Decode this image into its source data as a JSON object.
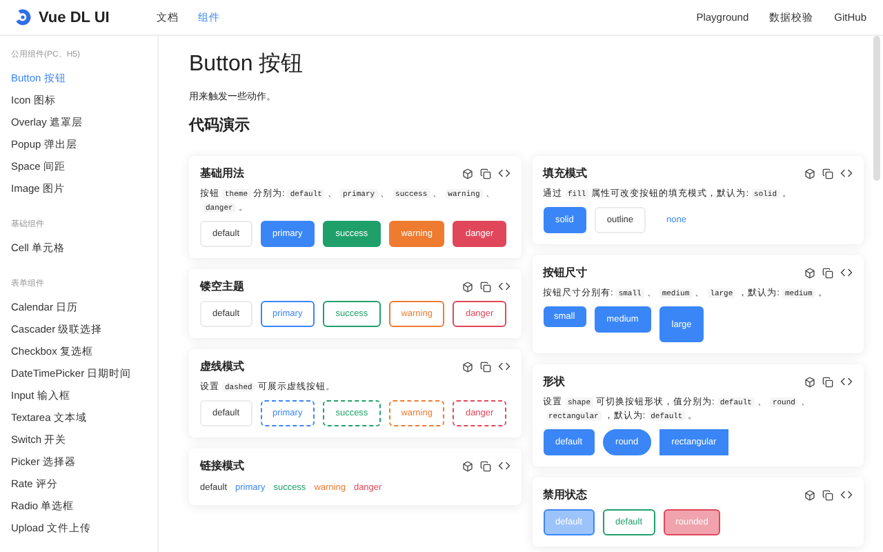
{
  "header": {
    "brand": "Vue DL UI",
    "nav": [
      {
        "label": "文档",
        "selected": false
      },
      {
        "label": "组件",
        "selected": true
      }
    ],
    "links": [
      "Playground",
      "数据校验",
      "GitHub"
    ]
  },
  "sidebar": {
    "groups": [
      {
        "label": "公用组件(PC、H5)",
        "items": [
          {
            "label": "Button 按钮",
            "selected": true
          },
          {
            "label": "Icon 图标",
            "selected": false
          },
          {
            "label": "Overlay 遮罩层",
            "selected": false
          },
          {
            "label": "Popup 弹出层",
            "selected": false
          },
          {
            "label": "Space 间距",
            "selected": false
          },
          {
            "label": "Image 图片",
            "selected": false
          }
        ]
      },
      {
        "label": "基础组件",
        "items": [
          {
            "label": "Cell 单元格",
            "selected": false
          }
        ]
      },
      {
        "label": "表单组件",
        "items": [
          {
            "label": "Calendar 日历",
            "selected": false
          },
          {
            "label": "Cascader 级联选择",
            "selected": false
          },
          {
            "label": "Checkbox 复选框",
            "selected": false
          },
          {
            "label": "DateTimePicker 日期时间",
            "selected": false
          },
          {
            "label": "Input 输入框",
            "selected": false
          },
          {
            "label": "Textarea 文本域",
            "selected": false
          },
          {
            "label": "Switch 开关",
            "selected": false
          },
          {
            "label": "Picker 选择器",
            "selected": false
          },
          {
            "label": "Rate 评分",
            "selected": false
          },
          {
            "label": "Radio 单选框",
            "selected": false
          },
          {
            "label": "Upload 文件上传",
            "selected": false
          }
        ]
      }
    ]
  },
  "page": {
    "title": "Button 按钮",
    "intro": "用来触发一些动作。",
    "section": "代码演示"
  },
  "columns": [
    [
      {
        "title": "基础用法",
        "description": [
          {
            "kind": "text",
            "text": "按钮"
          },
          {
            "kind": "code",
            "text": "theme"
          },
          {
            "kind": "text",
            "text": "分别为:"
          },
          {
            "kind": "code",
            "text": "default"
          },
          {
            "kind": "text",
            "text": "、"
          },
          {
            "kind": "code",
            "text": "primary"
          },
          {
            "kind": "text",
            "text": "、"
          },
          {
            "kind": "code",
            "text": "success"
          },
          {
            "kind": "text",
            "text": "、"
          },
          {
            "kind": "code",
            "text": "warning"
          },
          {
            "kind": "text",
            "text": "、"
          },
          {
            "kind": "code",
            "text": "danger"
          },
          {
            "kind": "text",
            "text": "。"
          }
        ],
        "buttons": [
          {
            "label": "default",
            "kind": "plain",
            "color": "#333333"
          },
          {
            "label": "primary",
            "kind": "solid",
            "color": "#3a86f7"
          },
          {
            "label": "success",
            "kind": "solid",
            "color": "#1fa06a"
          },
          {
            "label": "warning",
            "kind": "solid",
            "color": "#ee7b30"
          },
          {
            "label": "danger",
            "kind": "solid",
            "color": "#e0475a"
          }
        ]
      },
      {
        "title": "镂空主题",
        "buttons": [
          {
            "label": "default",
            "kind": "plain",
            "color": "#333333"
          },
          {
            "label": "primary",
            "kind": "ghost",
            "color": "#3a86f7"
          },
          {
            "label": "success",
            "kind": "ghost",
            "color": "#1fa06a"
          },
          {
            "label": "warning",
            "kind": "ghost",
            "color": "#ee7b30"
          },
          {
            "label": "danger",
            "kind": "ghost",
            "color": "#e0475a"
          }
        ]
      },
      {
        "title": "虚线模式",
        "description": [
          {
            "kind": "text",
            "text": "设置"
          },
          {
            "kind": "code",
            "text": "dashed"
          },
          {
            "kind": "text",
            "text": "可展示虚线按钮。"
          }
        ],
        "buttons": [
          {
            "label": "default",
            "kind": "plain",
            "color": "#333333"
          },
          {
            "label": "primary",
            "kind": "dashed",
            "color": "#3a86f7"
          },
          {
            "label": "success",
            "kind": "dashed",
            "color": "#1fa06a"
          },
          {
            "label": "warning",
            "kind": "dashed",
            "color": "#ee7b30"
          },
          {
            "label": "danger",
            "kind": "dashed",
            "color": "#e0475a"
          }
        ]
      },
      {
        "title": "链接模式",
        "buttons": [
          {
            "label": "default",
            "kind": "link",
            "color": "#333333"
          },
          {
            "label": "primary",
            "kind": "link",
            "color": "#3a86f7"
          },
          {
            "label": "success",
            "kind": "link",
            "color": "#1fa06a"
          },
          {
            "label": "warning",
            "kind": "link",
            "color": "#ee7b30"
          },
          {
            "label": "danger",
            "kind": "link",
            "color": "#e0475a"
          }
        ]
      }
    ],
    [
      {
        "title": "填充模式",
        "description": [
          {
            "kind": "text",
            "text": "通过"
          },
          {
            "kind": "code",
            "text": "fill"
          },
          {
            "kind": "text",
            "text": "属性可改变按钮的填充模式，默认为:"
          },
          {
            "kind": "code",
            "text": "solid"
          },
          {
            "kind": "text",
            "text": "。"
          }
        ],
        "buttons": [
          {
            "label": "solid",
            "kind": "solid",
            "color": "#3a86f7"
          },
          {
            "label": "outline",
            "kind": "plain",
            "color": "#333333"
          },
          {
            "label": "none",
            "kind": "none",
            "color": "#3a86f7"
          }
        ]
      },
      {
        "title": "按钮尺寸",
        "description": [
          {
            "kind": "text",
            "text": "按钮尺寸分别有:"
          },
          {
            "kind": "code",
            "text": "small"
          },
          {
            "kind": "text",
            "text": "、"
          },
          {
            "kind": "code",
            "text": "medium"
          },
          {
            "kind": "text",
            "text": "、"
          },
          {
            "kind": "code",
            "text": "large"
          },
          {
            "kind": "text",
            "text": "，默认为:"
          },
          {
            "kind": "code",
            "text": "medium"
          },
          {
            "kind": "text",
            "text": "。"
          }
        ],
        "buttons": [
          {
            "label": "small",
            "kind": "small",
            "color": "#3a86f7"
          },
          {
            "label": "medium",
            "kind": "solid",
            "color": "#3a86f7"
          },
          {
            "label": "large",
            "kind": "large",
            "color": "#3a86f7"
          }
        ]
      },
      {
        "title": "形状",
        "description": [
          {
            "kind": "text",
            "text": "设置"
          },
          {
            "kind": "code",
            "text": "shape"
          },
          {
            "kind": "text",
            "text": "可切换按钮形状，值分别为:"
          },
          {
            "kind": "code",
            "text": "default"
          },
          {
            "kind": "text",
            "text": "、"
          },
          {
            "kind": "code",
            "text": "round"
          },
          {
            "kind": "text",
            "text": "、"
          },
          {
            "kind": "code",
            "text": "rectangular"
          },
          {
            "kind": "text",
            "text": "，默认为:"
          },
          {
            "kind": "code",
            "text": "default"
          },
          {
            "kind": "text",
            "text": "。"
          }
        ],
        "buttons": [
          {
            "label": "default",
            "kind": "solid",
            "color": "#3a86f7"
          },
          {
            "label": "round",
            "kind": "round",
            "color": "#3a86f7"
          },
          {
            "label": "rectangular",
            "kind": "rectangular",
            "color": "#3a86f7"
          }
        ]
      },
      {
        "title": "禁用状态",
        "buttons": [
          {
            "label": "default",
            "kind": "solid",
            "color": "#3a86f7",
            "disabled": true
          },
          {
            "label": "default",
            "kind": "plain",
            "color": "#1fa06a",
            "disabled": true
          },
          {
            "label": "rounded",
            "kind": "solid",
            "color": "#e0475a",
            "disabled": true
          }
        ]
      }
    ]
  ]
}
